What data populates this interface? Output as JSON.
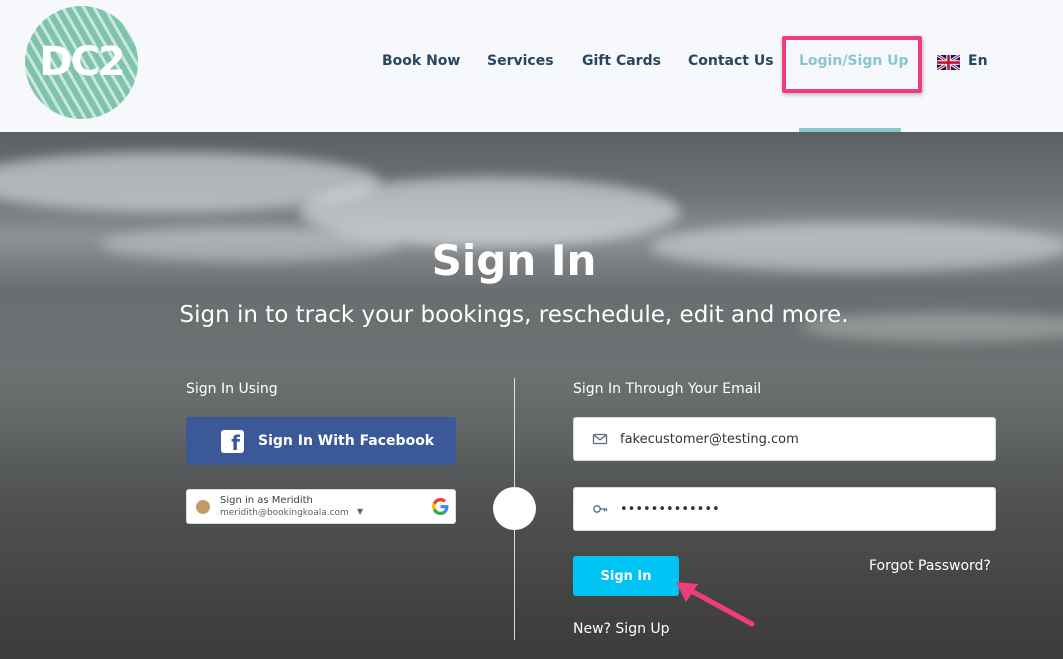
{
  "brand": {
    "logo_text": "DC2"
  },
  "nav": {
    "items": [
      {
        "label": "Book Now"
      },
      {
        "label": "Services"
      },
      {
        "label": "Gift Cards"
      },
      {
        "label": "Contact Us"
      },
      {
        "label": "Login/Sign Up"
      }
    ],
    "language": "En"
  },
  "hero": {
    "title": "Sign In",
    "subtitle": "Sign in to track your bookings, reschedule, edit and more."
  },
  "social": {
    "section_label": "Sign In Using",
    "facebook_label": "Sign In With Facebook",
    "google": {
      "name_line": "Sign in as Meridith",
      "email": "meridith@bookingkoala.com"
    }
  },
  "email_signin": {
    "section_label": "Sign In Through Your Email",
    "email_value": "fakecustomer@testing.com",
    "password_value": "•••••••••••••",
    "submit_label": "Sign In",
    "forgot_label": "Forgot Password?",
    "signup_label": "New? Sign Up"
  },
  "colors": {
    "nav_text": "#28475e",
    "nav_active": "#8ac6cf",
    "highlight": "#ee3e7a",
    "facebook": "#3b5998",
    "submit": "#00c4f4",
    "logo": "#7fc3ad"
  },
  "icons": {
    "email": "envelope-icon",
    "password": "key-icon",
    "facebook": "facebook-icon",
    "google": "google-icon",
    "language": "uk-flag-icon"
  }
}
